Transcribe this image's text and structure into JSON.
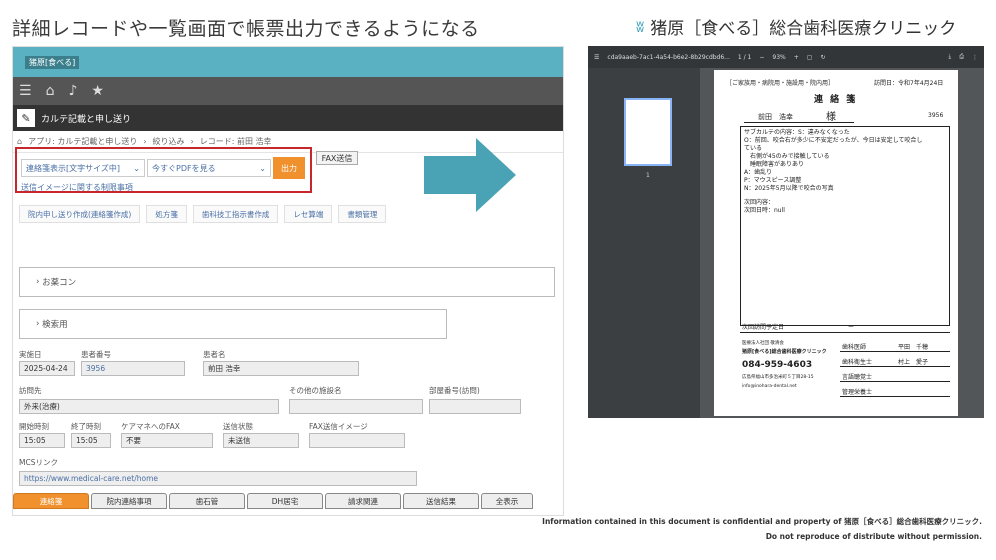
{
  "headline": "詳細レコードや一覧画面で帳票出力できるようになる",
  "brand": "猪原［食べる］総合歯科医療クリニック",
  "app": {
    "logo": "猪原[食べる]",
    "title": "カルテ記載と申し送り",
    "breadcrumb": [
      "アプリ: カルテ記載と申し送り",
      "絞り込み",
      "レコード: 前田 浩幸"
    ],
    "select1": "連絡箋表示[文字サイズ中]",
    "select2": "今すぐPDFを見る",
    "output_btn": "出力",
    "fax_btn": "FAX送信",
    "restrict_link": "送信イメージに関する制限事項",
    "actions": [
      "院内申し送り作成(連絡箋作成)",
      "処方箋",
      "歯科技工指示書作成",
      "レセ算端",
      "書類管理"
    ],
    "panel1": "お薬コン",
    "panel2": "検索用",
    "fields": {
      "date_label": "実施日",
      "date": "2025-04-24",
      "pid_label": "患者番号",
      "pid": "3956",
      "name_label": "患者名",
      "name": "前田 浩幸",
      "visit_label": "訪問先",
      "visit": "外来(治療)",
      "facility_label": "その他の施設名",
      "room_label": "部屋番号(訪問)",
      "start_label": "開始時刻",
      "start": "15:05",
      "end_label": "終了時刻",
      "end": "15:05",
      "care_label": "ケアマネへのFAX",
      "care": "不要",
      "status_label": "送信状態",
      "status": "未送信",
      "faximg_label": "FAX送信イメージ",
      "mcs_label": "MCSリンク",
      "mcs": "https://www.medical-care.net/home"
    },
    "tabs": [
      "連絡箋",
      "院内連絡事項",
      "歯石管",
      "DH居宅",
      "請求関連",
      "送信結果",
      "全表示"
    ]
  },
  "pdf": {
    "filename": "cda9aaeb-7ac1-4a54-b6e2-8b29cdbd6...",
    "pages": "1 / 1",
    "zoom": "93%",
    "header_left": "［ご家族用・病院用・施設用・院内用］",
    "date": "訪問日：令和7年4月24日",
    "title": "連 絡 箋",
    "patient": "前田　浩幸",
    "sama": "様",
    "pid": "3956",
    "body": [
      "サブカルテの内容：S：違みなくなった",
      "O：前回、咬合右が多少に不安定だったが、今日は安定して咬合し",
      "ている",
      "　右側が45のみで接触している",
      "　睡眠障害がありあり",
      "A：歯乱り",
      "P：マウスピース調整",
      "N：2025年5月以降で咬合の写真"
    ],
    "next1": "次回内容：",
    "next2": "次回日時：null",
    "next_visit": "次回訪問予定日",
    "dash": "ー",
    "clinic_small": "医療法人社団 敬清会",
    "clinic": "猪原[食べる]総合歯科医療クリニック",
    "phone": "084-959-4603",
    "address": "広島県福山市多治米町５丁目28-15",
    "email": "info@inohara-dental.net",
    "roles": [
      {
        "r": "歯科医師",
        "n": "平田　千穂"
      },
      {
        "r": "歯科衛生士",
        "n": "村上　愛子"
      },
      {
        "r": "言語聴覚士",
        "n": ""
      },
      {
        "r": "管理栄養士",
        "n": ""
      }
    ]
  },
  "footer1": "Information contained in this document is confidential and property of 猪原［食べる］総合歯科医療クリニック.",
  "footer2": "Do not reproduce of distribute without permission."
}
